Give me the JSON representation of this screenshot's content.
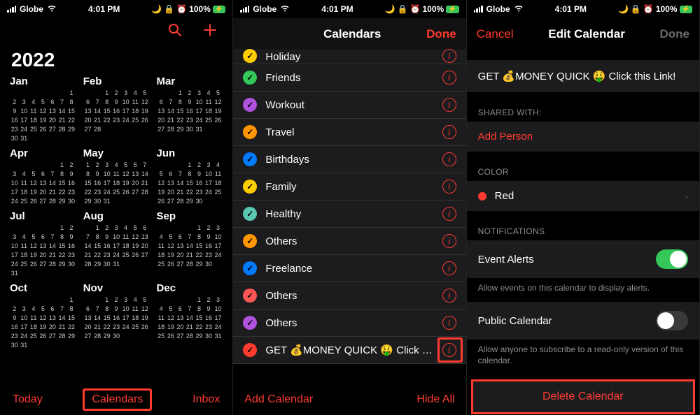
{
  "status": {
    "carrier": "Globe",
    "time": "4:01 PM",
    "battery_text": "100%"
  },
  "panel1": {
    "year": "2022",
    "months": [
      "Jan",
      "Feb",
      "Mar",
      "Apr",
      "May",
      "Jun",
      "Jul",
      "Aug",
      "Sep",
      "Oct",
      "Nov",
      "Dec"
    ],
    "month_start": [
      6,
      2,
      2,
      5,
      0,
      3,
      5,
      1,
      4,
      6,
      2,
      4
    ],
    "month_len": [
      31,
      28,
      31,
      30,
      31,
      30,
      31,
      31,
      30,
      31,
      30,
      31
    ],
    "today": "Today",
    "calendars": "Calendars",
    "inbox": "Inbox"
  },
  "panel2": {
    "title": "Calendars",
    "done": "Done",
    "add_calendar": "Add Calendar",
    "hide_all": "Hide All",
    "items": [
      {
        "label": "Holiday",
        "color": "#ffcc00",
        "cut": true
      },
      {
        "label": "Friends",
        "color": "#34c759"
      },
      {
        "label": "Workout",
        "color": "#af52de"
      },
      {
        "label": "Travel",
        "color": "#ff9500"
      },
      {
        "label": "Birthdays",
        "color": "#007aff"
      },
      {
        "label": "Family",
        "color": "#ffcc00"
      },
      {
        "label": "Healthy",
        "color": "#5ac8b0"
      },
      {
        "label": "Others",
        "color": "#ff9500"
      },
      {
        "label": "Freelance",
        "color": "#007aff"
      },
      {
        "label": "Others",
        "color": "#ff5555"
      },
      {
        "label": "Others",
        "color": "#af52de"
      },
      {
        "label": "GET 💰MONEY QUICK 🤑 Click this…",
        "color": "#ff3b30",
        "highlight_info": true
      }
    ]
  },
  "panel3": {
    "cancel": "Cancel",
    "title": "Edit Calendar",
    "done": "Done",
    "name": "GET 💰MONEY QUICK 🤑 Click this Link!",
    "shared_with": "SHARED WITH:",
    "add_person": "Add Person",
    "color_section": "COLOR",
    "color_name": "Red",
    "notifications": "NOTIFICATIONS",
    "event_alerts": "Event Alerts",
    "event_alerts_caption": "Allow events on this calendar to display alerts.",
    "public_calendar": "Public Calendar",
    "public_caption": "Allow anyone to subscribe to a read-only version of this calendar.",
    "delete": "Delete Calendar"
  }
}
